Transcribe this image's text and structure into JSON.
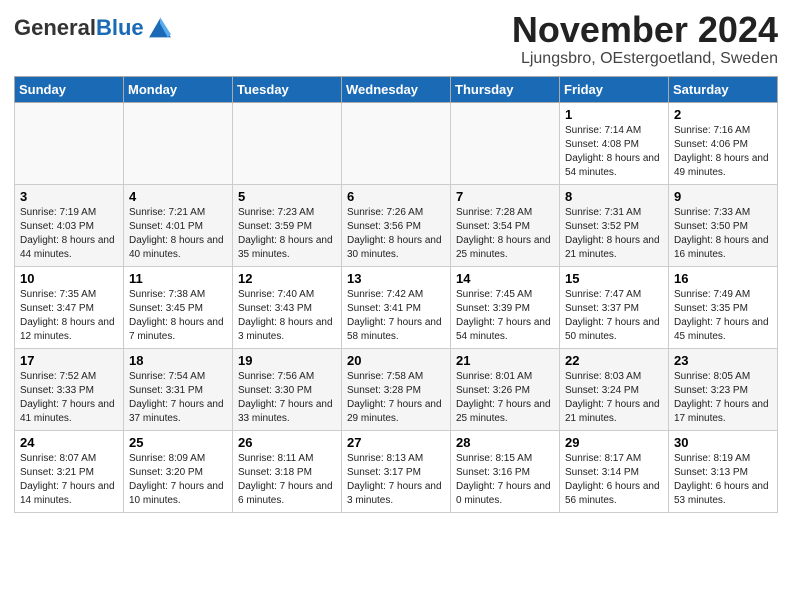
{
  "header": {
    "logo_line1": "General",
    "logo_line2": "Blue",
    "month_title": "November 2024",
    "location": "Ljungsbro, OEstergoetland, Sweden"
  },
  "weekdays": [
    "Sunday",
    "Monday",
    "Tuesday",
    "Wednesday",
    "Thursday",
    "Friday",
    "Saturday"
  ],
  "weeks": [
    [
      {
        "day": "",
        "info": ""
      },
      {
        "day": "",
        "info": ""
      },
      {
        "day": "",
        "info": ""
      },
      {
        "day": "",
        "info": ""
      },
      {
        "day": "",
        "info": ""
      },
      {
        "day": "1",
        "info": "Sunrise: 7:14 AM\nSunset: 4:08 PM\nDaylight: 8 hours and 54 minutes."
      },
      {
        "day": "2",
        "info": "Sunrise: 7:16 AM\nSunset: 4:06 PM\nDaylight: 8 hours and 49 minutes."
      }
    ],
    [
      {
        "day": "3",
        "info": "Sunrise: 7:19 AM\nSunset: 4:03 PM\nDaylight: 8 hours and 44 minutes."
      },
      {
        "day": "4",
        "info": "Sunrise: 7:21 AM\nSunset: 4:01 PM\nDaylight: 8 hours and 40 minutes."
      },
      {
        "day": "5",
        "info": "Sunrise: 7:23 AM\nSunset: 3:59 PM\nDaylight: 8 hours and 35 minutes."
      },
      {
        "day": "6",
        "info": "Sunrise: 7:26 AM\nSunset: 3:56 PM\nDaylight: 8 hours and 30 minutes."
      },
      {
        "day": "7",
        "info": "Sunrise: 7:28 AM\nSunset: 3:54 PM\nDaylight: 8 hours and 25 minutes."
      },
      {
        "day": "8",
        "info": "Sunrise: 7:31 AM\nSunset: 3:52 PM\nDaylight: 8 hours and 21 minutes."
      },
      {
        "day": "9",
        "info": "Sunrise: 7:33 AM\nSunset: 3:50 PM\nDaylight: 8 hours and 16 minutes."
      }
    ],
    [
      {
        "day": "10",
        "info": "Sunrise: 7:35 AM\nSunset: 3:47 PM\nDaylight: 8 hours and 12 minutes."
      },
      {
        "day": "11",
        "info": "Sunrise: 7:38 AM\nSunset: 3:45 PM\nDaylight: 8 hours and 7 minutes."
      },
      {
        "day": "12",
        "info": "Sunrise: 7:40 AM\nSunset: 3:43 PM\nDaylight: 8 hours and 3 minutes."
      },
      {
        "day": "13",
        "info": "Sunrise: 7:42 AM\nSunset: 3:41 PM\nDaylight: 7 hours and 58 minutes."
      },
      {
        "day": "14",
        "info": "Sunrise: 7:45 AM\nSunset: 3:39 PM\nDaylight: 7 hours and 54 minutes."
      },
      {
        "day": "15",
        "info": "Sunrise: 7:47 AM\nSunset: 3:37 PM\nDaylight: 7 hours and 50 minutes."
      },
      {
        "day": "16",
        "info": "Sunrise: 7:49 AM\nSunset: 3:35 PM\nDaylight: 7 hours and 45 minutes."
      }
    ],
    [
      {
        "day": "17",
        "info": "Sunrise: 7:52 AM\nSunset: 3:33 PM\nDaylight: 7 hours and 41 minutes."
      },
      {
        "day": "18",
        "info": "Sunrise: 7:54 AM\nSunset: 3:31 PM\nDaylight: 7 hours and 37 minutes."
      },
      {
        "day": "19",
        "info": "Sunrise: 7:56 AM\nSunset: 3:30 PM\nDaylight: 7 hours and 33 minutes."
      },
      {
        "day": "20",
        "info": "Sunrise: 7:58 AM\nSunset: 3:28 PM\nDaylight: 7 hours and 29 minutes."
      },
      {
        "day": "21",
        "info": "Sunrise: 8:01 AM\nSunset: 3:26 PM\nDaylight: 7 hours and 25 minutes."
      },
      {
        "day": "22",
        "info": "Sunrise: 8:03 AM\nSunset: 3:24 PM\nDaylight: 7 hours and 21 minutes."
      },
      {
        "day": "23",
        "info": "Sunrise: 8:05 AM\nSunset: 3:23 PM\nDaylight: 7 hours and 17 minutes."
      }
    ],
    [
      {
        "day": "24",
        "info": "Sunrise: 8:07 AM\nSunset: 3:21 PM\nDaylight: 7 hours and 14 minutes."
      },
      {
        "day": "25",
        "info": "Sunrise: 8:09 AM\nSunset: 3:20 PM\nDaylight: 7 hours and 10 minutes."
      },
      {
        "day": "26",
        "info": "Sunrise: 8:11 AM\nSunset: 3:18 PM\nDaylight: 7 hours and 6 minutes."
      },
      {
        "day": "27",
        "info": "Sunrise: 8:13 AM\nSunset: 3:17 PM\nDaylight: 7 hours and 3 minutes."
      },
      {
        "day": "28",
        "info": "Sunrise: 8:15 AM\nSunset: 3:16 PM\nDaylight: 7 hours and 0 minutes."
      },
      {
        "day": "29",
        "info": "Sunrise: 8:17 AM\nSunset: 3:14 PM\nDaylight: 6 hours and 56 minutes."
      },
      {
        "day": "30",
        "info": "Sunrise: 8:19 AM\nSunset: 3:13 PM\nDaylight: 6 hours and 53 minutes."
      }
    ]
  ]
}
